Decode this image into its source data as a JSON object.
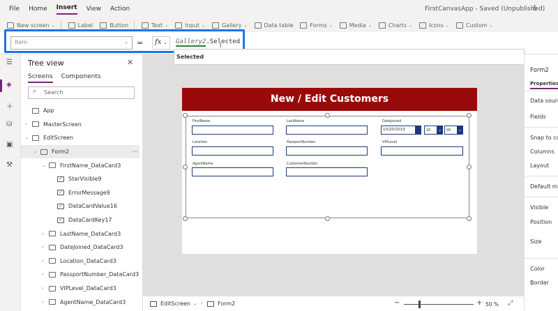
{
  "menu": {
    "items": [
      "File",
      "Home",
      "Insert",
      "View",
      "Action"
    ],
    "active_index": 2,
    "app_title": "FirstCanvasApp - Saved (Unpublished)"
  },
  "ribbon": {
    "new_screen": "New screen",
    "label": "Label",
    "button": "Button",
    "text": "Text",
    "input": "Input",
    "gallery": "Gallery",
    "data_table": "Data table",
    "forms": "Forms",
    "media": "Media",
    "charts": "Charts",
    "icons": "Icons",
    "custom": "Custom"
  },
  "formula_bar": {
    "property": "Item",
    "equals": "=",
    "fx": "fx",
    "token": "Gallery2",
    "rest": ".Selected",
    "suggestion": "Selected"
  },
  "tree": {
    "title": "Tree view",
    "tabs": [
      "Screens",
      "Components"
    ],
    "search_placeholder": "Search",
    "items": [
      {
        "label": "App",
        "indent": 0,
        "arrow": ""
      },
      {
        "label": "MasterScreen",
        "indent": 0,
        "arrow": "›"
      },
      {
        "label": "EditScreen",
        "indent": 0,
        "arrow": "⌄"
      },
      {
        "label": "Form2",
        "indent": 1,
        "arrow": "⌄"
      },
      {
        "label": "FirstName_DataCard3",
        "indent": 2,
        "arrow": "⌄"
      },
      {
        "label": "StarVisible9",
        "indent": 3,
        "arrow": ""
      },
      {
        "label": "ErrorMessage9",
        "indent": 3,
        "arrow": ""
      },
      {
        "label": "DataCardValue16",
        "indent": 3,
        "arrow": ""
      },
      {
        "label": "DataCardKey17",
        "indent": 3,
        "arrow": ""
      },
      {
        "label": "LastName_DataCard3",
        "indent": 2,
        "arrow": "›"
      },
      {
        "label": "DateJoined_DataCard3",
        "indent": 2,
        "arrow": "›"
      },
      {
        "label": "Location_DataCard3",
        "indent": 2,
        "arrow": "›"
      },
      {
        "label": "PassportNumber_DataCard3",
        "indent": 2,
        "arrow": "›"
      },
      {
        "label": "VIPLevel_DataCard3",
        "indent": 2,
        "arrow": "›"
      },
      {
        "label": "AgentName_DataCard3",
        "indent": 2,
        "arrow": "›"
      }
    ]
  },
  "canvas": {
    "banner": "New / Edit Customers",
    "fields": {
      "first_name": "FirstName",
      "last_name": "LastName",
      "date_joined": "DateJoined",
      "location": "Location",
      "passport": "PassportNumber",
      "vip": "VIPLevel",
      "agent": "AgentName",
      "customer": "CustomerNumber"
    },
    "date_value": "10/20/2019",
    "hour_value": "20",
    "minute_value": "00"
  },
  "properties": {
    "title": "Form2",
    "tab": "Properties",
    "items": [
      "Data source",
      "Fields",
      "Snap to columns",
      "Columns",
      "Layout",
      "Default mode",
      "Visible",
      "Position",
      "Size",
      "Color",
      "Border"
    ]
  },
  "bottom": {
    "screen": "EditScreen",
    "control": "Form2",
    "zoom_minus": "−",
    "zoom_plus": "+",
    "zoom": "50  %"
  }
}
